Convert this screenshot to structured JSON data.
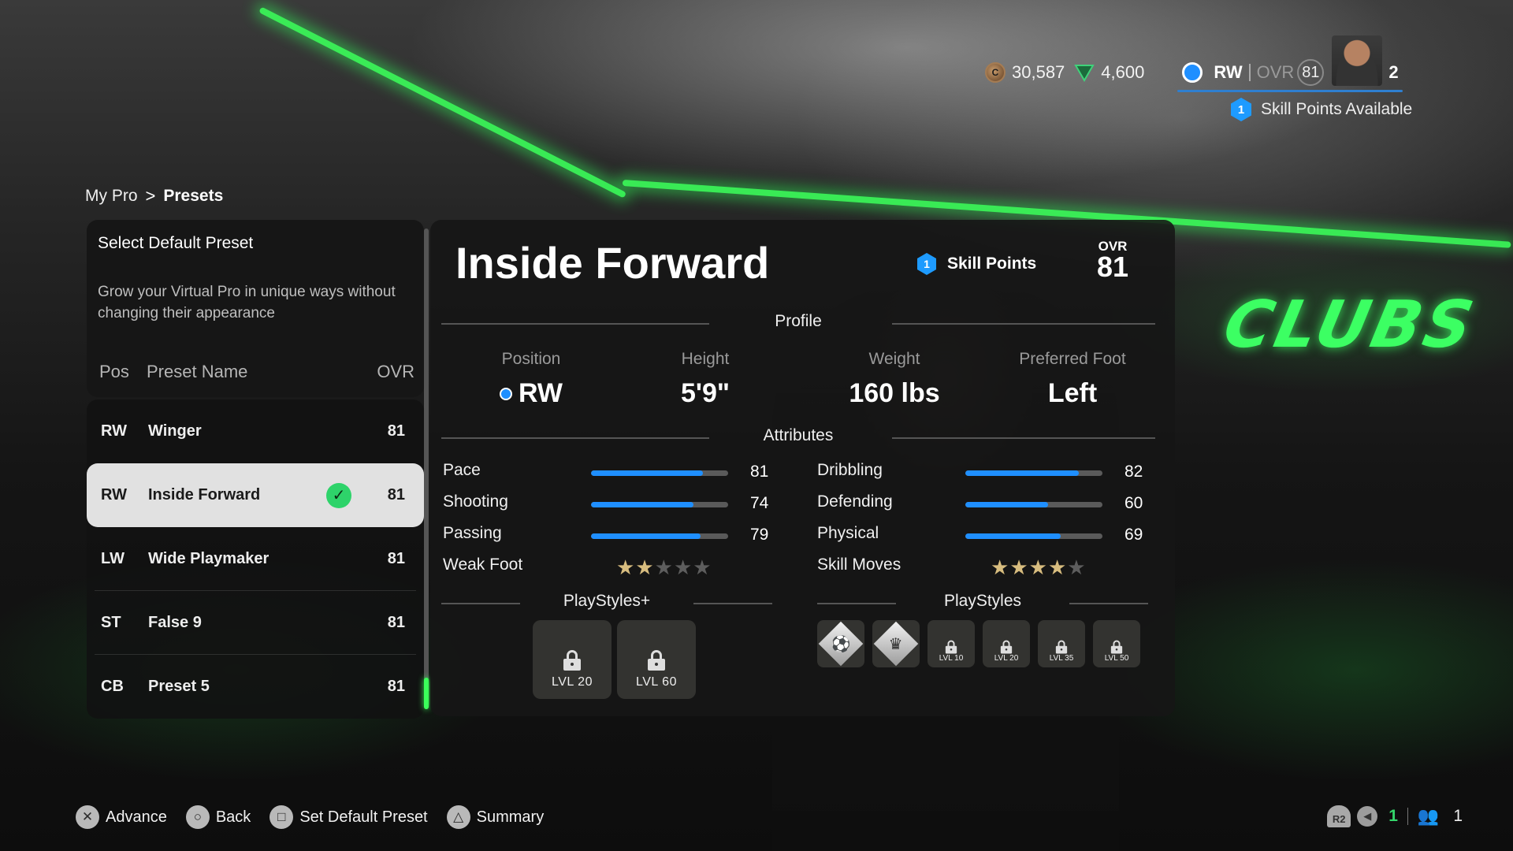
{
  "hud": {
    "coins": "30,587",
    "points": "4,600",
    "position": "RW",
    "ovr_label": "OVR",
    "ovr_value": "81",
    "level": "2",
    "skill_points_count": "1",
    "skill_points_text": "Skill Points Available"
  },
  "breadcrumb": {
    "parent": "My Pro",
    "separator": ">",
    "current": "Presets"
  },
  "left_panel": {
    "title": "Select Default Preset",
    "description": "Grow your Virtual Pro in unique ways without changing their appearance",
    "columns": {
      "pos": "Pos",
      "name": "Preset Name",
      "ovr": "OVR"
    },
    "rows": [
      {
        "pos": "RW",
        "name": "Winger",
        "ovr": "81",
        "selected": false
      },
      {
        "pos": "RW",
        "name": "Inside Forward",
        "ovr": "81",
        "selected": true
      },
      {
        "pos": "LW",
        "name": "Wide Playmaker",
        "ovr": "81",
        "selected": false
      },
      {
        "pos": "ST",
        "name": "False 9",
        "ovr": "81",
        "selected": false
      },
      {
        "pos": "CB",
        "name": "Preset 5",
        "ovr": "81",
        "selected": false
      }
    ]
  },
  "detail": {
    "title": "Inside Forward",
    "skill_points_count": "1",
    "skill_points_label": "Skill Points",
    "ovr_label": "OVR",
    "ovr_value": "81",
    "profile_label": "Profile",
    "profile": [
      {
        "key": "Position",
        "value": "RW"
      },
      {
        "key": "Height",
        "value": "5'9\""
      },
      {
        "key": "Weight",
        "value": "160 lbs"
      },
      {
        "key": "Preferred Foot",
        "value": "Left"
      }
    ],
    "attributes_label": "Attributes",
    "attributes_left": [
      {
        "name": "Pace",
        "value": 81
      },
      {
        "name": "Shooting",
        "value": 74
      },
      {
        "name": "Passing",
        "value": 79
      }
    ],
    "attributes_right": [
      {
        "name": "Dribbling",
        "value": 82
      },
      {
        "name": "Defending",
        "value": 60
      },
      {
        "name": "Physical",
        "value": 69
      }
    ],
    "weak_foot": {
      "label": "Weak Foot",
      "stars": 2,
      "max": 5
    },
    "skill_moves": {
      "label": "Skill Moves",
      "stars": 4,
      "max": 5
    },
    "playstyles_plus_label": "PlayStyles+",
    "playstyles_plus": [
      {
        "locked": true,
        "level": "LVL 20"
      },
      {
        "locked": true,
        "level": "LVL 60"
      }
    ],
    "playstyles_label": "PlayStyles",
    "playstyles": [
      {
        "locked": false,
        "icon": "ball-control-playstyle-icon"
      },
      {
        "locked": false,
        "icon": "trickster-playstyle-icon"
      },
      {
        "locked": true,
        "level": "LVL 10"
      },
      {
        "locked": true,
        "level": "LVL 20"
      },
      {
        "locked": true,
        "level": "LVL 35"
      },
      {
        "locked": true,
        "level": "LVL 50"
      }
    ]
  },
  "footer": {
    "buttons": [
      {
        "glyph": "✕",
        "label": "Advance"
      },
      {
        "glyph": "○",
        "label": "Back"
      },
      {
        "glyph": "□",
        "label": "Set Default Preset"
      },
      {
        "glyph": "△",
        "label": "Summary"
      }
    ],
    "status": {
      "r2_label": "R2",
      "voice_count": "1",
      "party_count": "1"
    }
  },
  "colors": {
    "accent_blue": "#1f8fff",
    "neon_green": "#3bff5a",
    "check_green": "#2ed36a",
    "star_gold": "#d8bd7f"
  }
}
